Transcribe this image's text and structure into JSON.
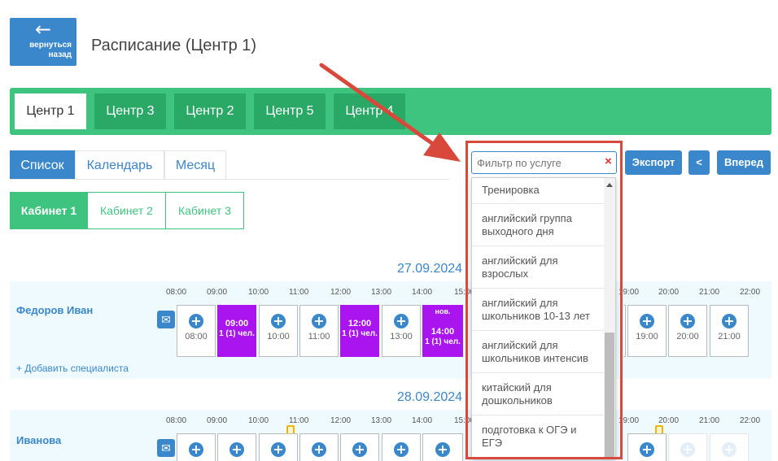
{
  "header": {
    "back_label_1": "вернуться",
    "back_label_2": "назад",
    "title": "Расписание (Центр 1)"
  },
  "centers": [
    "Центр 1",
    "Центр 3",
    "Центр 2",
    "Центр 5",
    "Центр 4"
  ],
  "views": [
    "Список",
    "Календарь",
    "Месяц"
  ],
  "cabinets": [
    "Кабинет 1",
    "Кабинет 2",
    "Кабинет 3"
  ],
  "filter": {
    "placeholder": "Фильтр по услуге",
    "clear": "×"
  },
  "buttons": {
    "export": "Экспорт",
    "prev": "<",
    "next": "Вперед"
  },
  "hours": [
    "08:00",
    "09:00",
    "10:00",
    "11:00",
    "12:00",
    "13:00",
    "14:00",
    "15:00",
    "19:00",
    "20:00",
    "21:00",
    "22:00"
  ],
  "day1": {
    "date": "27.09.2024",
    "specialist": "Федоров Иван",
    "slots": [
      "08:00",
      "10:00",
      "11:00",
      "13:00",
      "19:00",
      "20:00",
      "21:00"
    ],
    "booked": [
      {
        "time": "09:00",
        "count": "1 (1) чел."
      },
      {
        "time": "12:00",
        "count": "1 (1) чел."
      },
      {
        "note": "нов.",
        "time": "14:00",
        "count": "1 (1) чел."
      }
    ]
  },
  "add_specialist": "Добавить специалиста",
  "day2": {
    "date": "28.09.2024",
    "specialist": "Иванова"
  },
  "services": [
    "Тренировка",
    "английский группа выходного дня",
    "английский для взрослых",
    "английский для школьников 10-13 лет",
    "английский для школьников интенсив",
    "китайский для дошкольников",
    "подготовка к ОГЭ и ЕГЭ"
  ],
  "icons": {
    "back": "arrow-left-icon",
    "mail": "envelope-icon",
    "plus": "plus-circle-icon",
    "phone": "phone-icon"
  },
  "colors": {
    "primary": "#3a87cc",
    "green": "#3fc47f",
    "booked": "#aa14ee",
    "highlight": "#d9493b"
  }
}
